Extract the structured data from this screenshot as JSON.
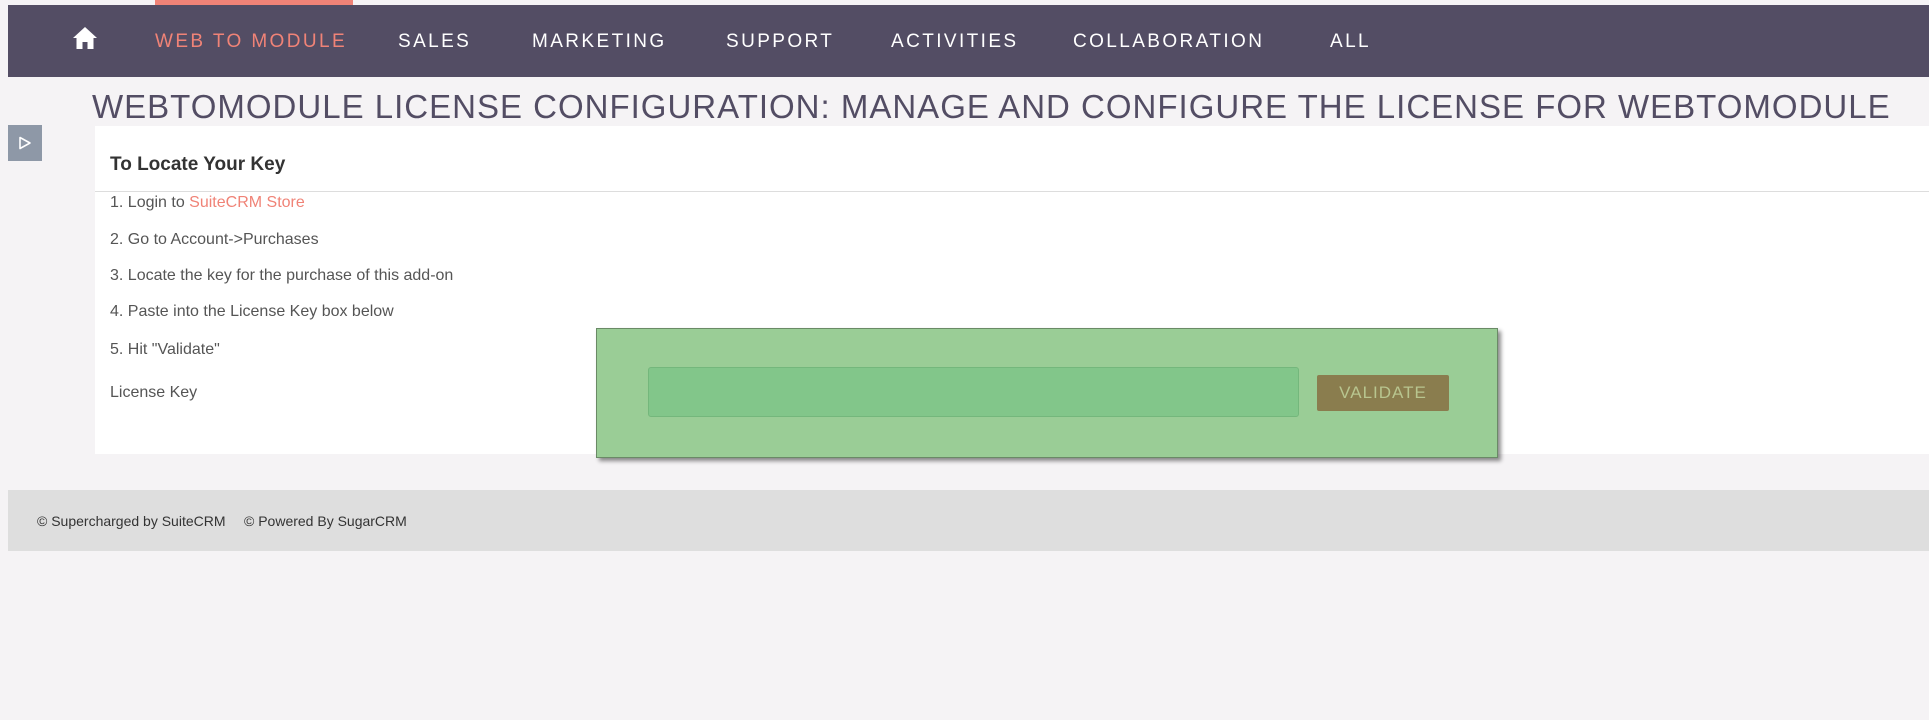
{
  "nav": {
    "items": [
      {
        "label": "WEB TO MODULE",
        "active": true
      },
      {
        "label": "SALES"
      },
      {
        "label": "MARKETING"
      },
      {
        "label": "SUPPORT"
      },
      {
        "label": "ACTIVITIES"
      },
      {
        "label": "COLLABORATION"
      },
      {
        "label": "ALL"
      }
    ],
    "home_icon": "home-icon"
  },
  "page": {
    "title": "WEBTOMODULE LICENSE CONFIGURATION: MANAGE AND CONFIGURE THE LICENSE FOR WEBTOMODULE"
  },
  "panel": {
    "heading": "To Locate Your Key",
    "steps": [
      {
        "prefix": "1. Login to ",
        "link": "SuiteCRM Store"
      },
      {
        "text": "2. Go to Account->Purchases"
      },
      {
        "text": "3. Locate the key for the purchase of this add-on"
      },
      {
        "text": "4. Paste into the License Key box below"
      },
      {
        "text": "5. Hit \"Validate\""
      }
    ],
    "license_label": "License Key",
    "license_value": "",
    "validate_label": "VALIDATE"
  },
  "footer": {
    "suitecrm": "© Supercharged by SuiteCRM",
    "sugarcrm": "© Powered By SugarCRM"
  },
  "colors": {
    "nav_bg": "#534d64",
    "accent": "#f08377",
    "overlay": "#9acd96",
    "validate_bg": "#8a7d4e"
  }
}
